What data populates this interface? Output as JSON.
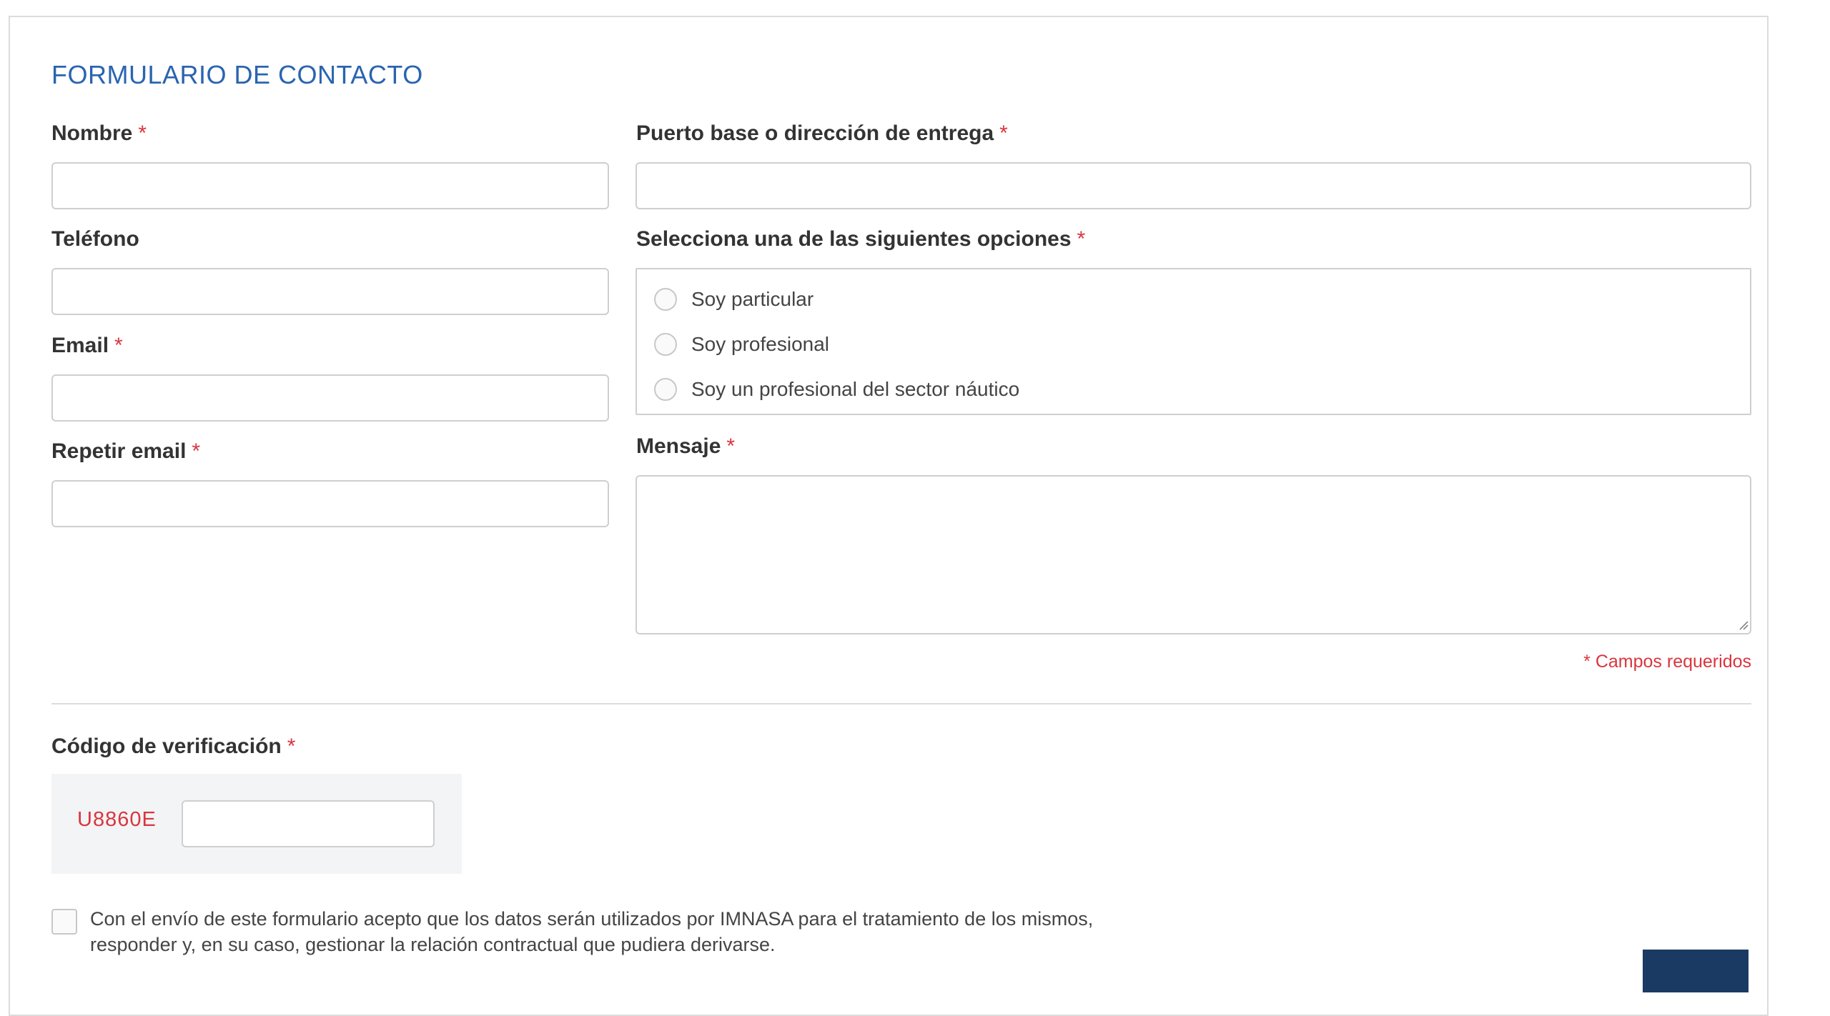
{
  "form": {
    "title": "FORMULARIO DE CONTACTO",
    "required_mark": "*",
    "fields": {
      "nombre": {
        "label": "Nombre",
        "required": true,
        "value": ""
      },
      "telefono": {
        "label": "Teléfono",
        "required": false,
        "value": ""
      },
      "email": {
        "label": "Email",
        "required": true,
        "value": ""
      },
      "repetir_email": {
        "label": "Repetir email",
        "required": true,
        "value": ""
      },
      "puerto": {
        "label": "Puerto base o dirección de entrega",
        "required": true,
        "value": ""
      },
      "mensaje": {
        "label": "Mensaje",
        "required": true,
        "value": ""
      }
    },
    "options": {
      "label": "Selecciona una de las siguientes opciones",
      "required": true,
      "items": [
        {
          "label": "Soy particular",
          "selected": false
        },
        {
          "label": "Soy profesional",
          "selected": false
        },
        {
          "label": "Soy un profesional del sector náutico",
          "selected": false
        }
      ]
    },
    "required_note": "* Campos requeridos",
    "verification": {
      "label": "Código de verificación",
      "required": true,
      "code": "U8860E",
      "value": ""
    },
    "consent": {
      "checked": false,
      "text": "Con el envío de este formulario acepto que los datos serán utilizados por IMNASA para el tratamiento de los mismos, responder y, en su caso, gestionar la relación contractual que pudiera derivarse."
    }
  },
  "colors": {
    "title": "#2a64b0",
    "required": "#d9363e",
    "submit_bg": "#1b3a63",
    "border": "#cfcfcf"
  }
}
